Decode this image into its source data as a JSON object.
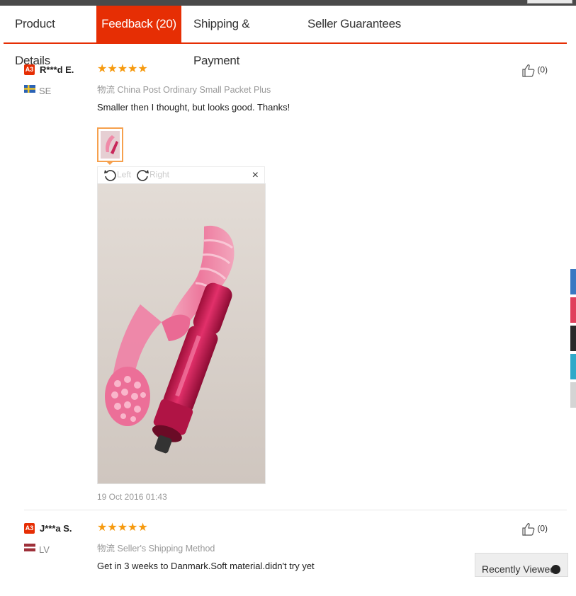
{
  "tabs": [
    {
      "label": "Product Details",
      "active": false
    },
    {
      "label": "Feedback (20)",
      "active": true
    },
    {
      "label": "Shipping & Payment",
      "active": false
    },
    {
      "label": "Seller Guarantees",
      "active": false
    }
  ],
  "reviews": [
    {
      "level": "A3",
      "user": "R***d E.",
      "country": "SE",
      "stars": "★★★★★",
      "rating": 5,
      "logistics_prefix": "物流",
      "logistics": "China Post Ordinary Small Packet Plus",
      "comment": "Smaller then I thought, but looks good. Thanks!",
      "likes": "(0)",
      "viewer": {
        "rotate_left": "Left",
        "rotate_right": "Right",
        "close": "×"
      },
      "date": "19 Oct 2016 01:43"
    },
    {
      "level": "A3",
      "user": "J***a S.",
      "country": "LV",
      "stars": "★★★★★",
      "rating": 5,
      "logistics_prefix": "物流",
      "logistics": "Seller's Shipping Method",
      "comment": "Get in 3 weeks to Danmark.Soft material.didn't try yet",
      "likes": "(0)"
    }
  ],
  "recently_viewed": {
    "label": "Recently Viewed",
    "icon": "chevron-up-icon"
  },
  "colors": {
    "accent": "#e62e04",
    "stars": "#f69a0f",
    "muted": "#999999"
  }
}
